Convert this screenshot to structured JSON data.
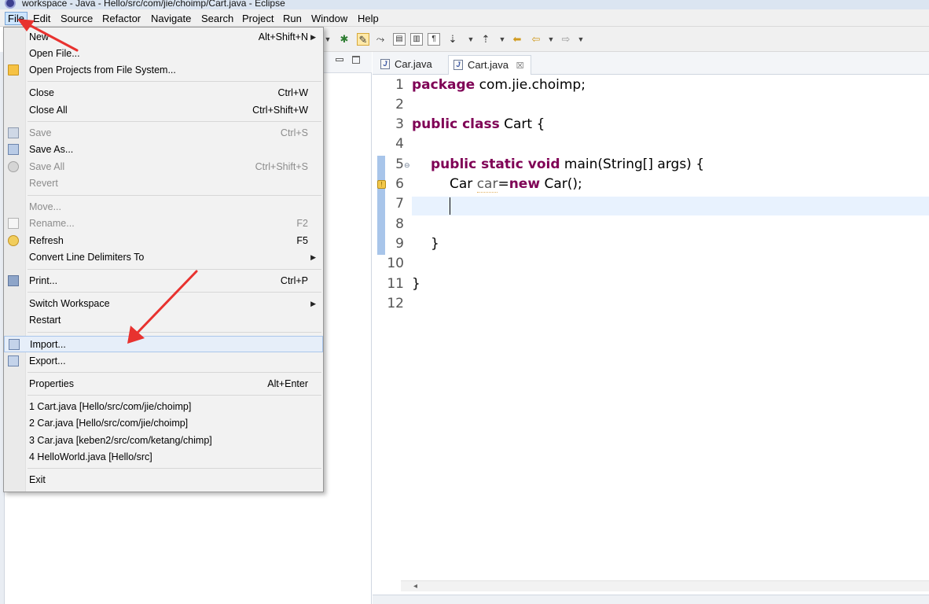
{
  "window": {
    "title": "workspace - Java - Hello/src/com/jie/choimp/Cart.java - Eclipse"
  },
  "menubar": [
    "File",
    "Edit",
    "Source",
    "Refactor",
    "Navigate",
    "Search",
    "Project",
    "Run",
    "Window",
    "Help"
  ],
  "editor": {
    "tabs": [
      {
        "label": "Car.java",
        "active": false
      },
      {
        "label": "Cart.java",
        "active": true
      }
    ],
    "line_numbers": [
      "1",
      "2",
      "3",
      "4",
      "5",
      "6",
      "7",
      "8",
      "9",
      "10",
      "11",
      "12"
    ],
    "code": {
      "l1_kw": "package",
      "l1_rest": " com.jie.choimp;",
      "l3_kw": "public class",
      "l3_rest": " Cart {",
      "l5_kw": "public static void",
      "l5_rest": " main(String[] args) {",
      "l6_a": "Car ",
      "l6_var": "car",
      "l6_b": "=",
      "l6_kw": "new",
      "l6_c": " Car();",
      "l9": "}",
      "l11": "}"
    }
  },
  "file_menu": {
    "new": {
      "label": "New",
      "shortcut": "Alt+Shift+N"
    },
    "open_file": {
      "label": "Open File..."
    },
    "open_projects": {
      "label": "Open Projects from File System..."
    },
    "close": {
      "label": "Close",
      "shortcut": "Ctrl+W"
    },
    "close_all": {
      "label": "Close All",
      "shortcut": "Ctrl+Shift+W"
    },
    "save": {
      "label": "Save",
      "shortcut": "Ctrl+S"
    },
    "save_as": {
      "label": "Save As..."
    },
    "save_all": {
      "label": "Save All",
      "shortcut": "Ctrl+Shift+S"
    },
    "revert": {
      "label": "Revert"
    },
    "move": {
      "label": "Move..."
    },
    "rename": {
      "label": "Rename...",
      "shortcut": "F2"
    },
    "refresh": {
      "label": "Refresh",
      "shortcut": "F5"
    },
    "convert": {
      "label": "Convert Line Delimiters To"
    },
    "print": {
      "label": "Print...",
      "shortcut": "Ctrl+P"
    },
    "switch_workspace": {
      "label": "Switch Workspace"
    },
    "restart": {
      "label": "Restart"
    },
    "import": {
      "label": "Import..."
    },
    "export": {
      "label": "Export..."
    },
    "properties": {
      "label": "Properties",
      "shortcut": "Alt+Enter"
    },
    "recent": [
      "1 Cart.java  [Hello/src/com/jie/choimp]",
      "2 Car.java  [Hello/src/com/jie/choimp]",
      "3 Car.java  [keben2/src/com/ketang/chimp]",
      "4 HelloWorld.java  [Hello/src]"
    ],
    "exit": {
      "label": "Exit"
    }
  },
  "colors": {
    "keyword": "#7f0055",
    "annotation_arrow": "#e8322f",
    "menu_highlight": "#e6eef9"
  },
  "icons": {
    "menu_submenu": "chevron-right-icon",
    "tab_file": "java-file-icon",
    "tab_close": "close-icon"
  }
}
